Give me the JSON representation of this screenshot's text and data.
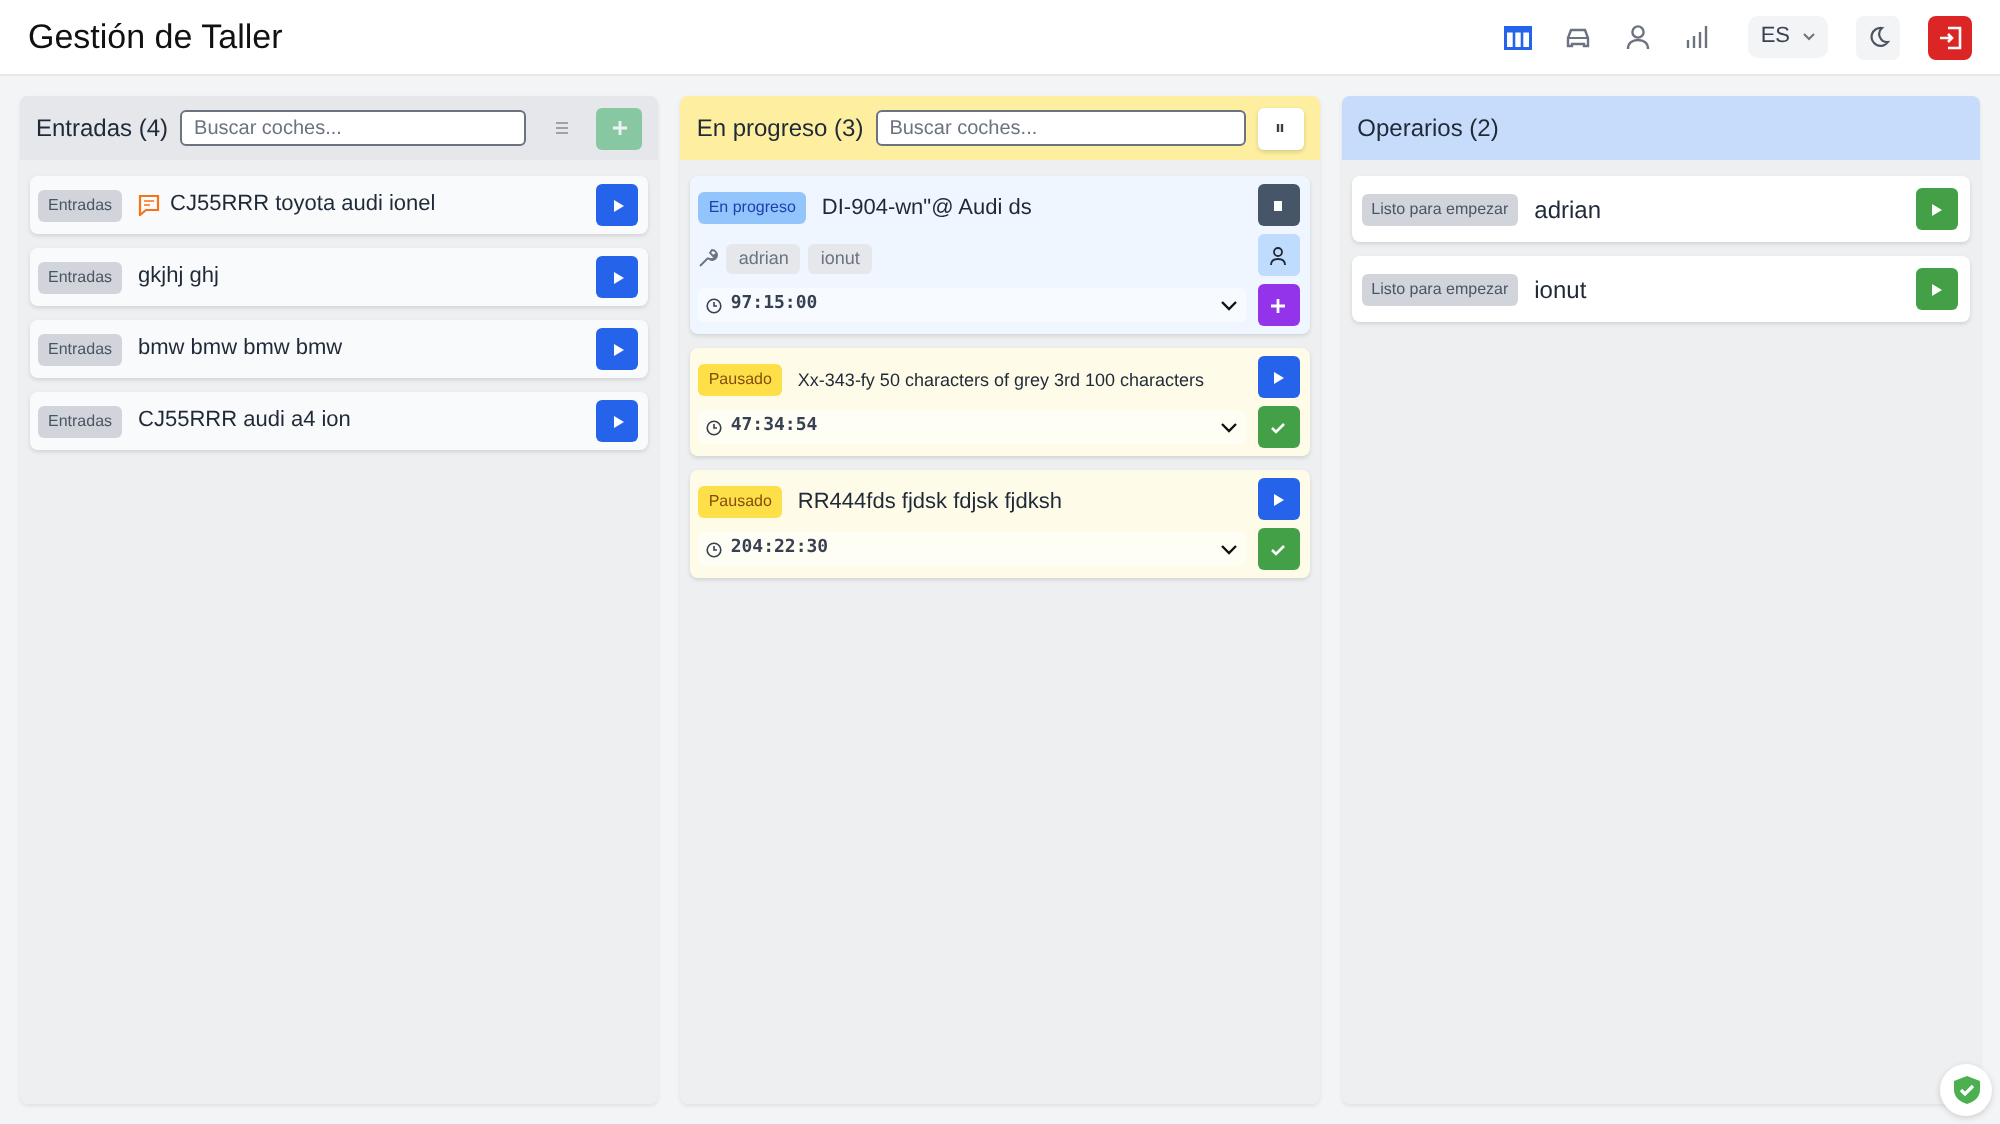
{
  "app_title": "Gestión de Taller",
  "nav_icons": [
    {
      "kind": "board",
      "selected": true
    },
    {
      "kind": "car",
      "selected": false
    },
    {
      "kind": "person",
      "selected": false
    },
    {
      "kind": "stats",
      "selected": false
    }
  ],
  "language": "ES",
  "columns": [
    {
      "kind": "cars",
      "title": "Entradas (4)",
      "color": "#e5e7eb",
      "search": {
        "placeholder": "Buscar coches..."
      },
      "header_buttons": [
        {
          "kind": "list",
          "disabled": false
        },
        {
          "kind": "add",
          "disabled": true
        }
      ],
      "cards": [
        {
          "kind": "entrada",
          "badge": "Entradas",
          "comment": true,
          "title": "CJ55RRR toyota audi ionel",
          "buttons": [
            {
              "kind": "play"
            }
          ]
        },
        {
          "kind": "entrada",
          "badge": "Entradas",
          "title": "gkjhj ghj",
          "buttons": [
            {
              "kind": "play"
            }
          ]
        },
        {
          "kind": "entrada",
          "badge": "Entradas",
          "title": "bmw bmw bmw bmw",
          "buttons": [
            {
              "kind": "play"
            }
          ]
        },
        {
          "kind": "entrada",
          "badge": "Entradas",
          "title": "CJ55RRR audi a4 ion",
          "buttons": [
            {
              "kind": "play"
            }
          ]
        }
      ]
    },
    {
      "kind": "cars",
      "title": "En progreso (3)",
      "color": "#fdef9f",
      "search": {
        "placeholder": "Buscar coches..."
      },
      "header_buttons": [
        {
          "kind": "pause",
          "disabled": false
        }
      ],
      "cards": [
        {
          "kind": "progreso",
          "badge": "En progreso",
          "title": "DI-904-wn\"@ Audi ds",
          "workers": [
            "adrian",
            "ionut"
          ],
          "timer": "97:15:00",
          "expanded": false,
          "buttons": [
            {
              "kind": "stop"
            },
            {
              "kind": "person"
            },
            {
              "kind": "add"
            }
          ]
        },
        {
          "kind": "pausado",
          "badge": "Pausado",
          "small_title": true,
          "title": "Xx-343-fy 50 characters of grey 3rd 100 characters",
          "timer": "47:34:54",
          "expanded": false,
          "buttons": [
            {
              "kind": "play"
            },
            {
              "kind": "done"
            }
          ]
        },
        {
          "kind": "pausado",
          "badge": "Pausado",
          "title": "RR444fds fjdsk fdjsk fjdksh",
          "timer": "204:22:30",
          "expanded": false,
          "buttons": [
            {
              "kind": "play"
            },
            {
              "kind": "done"
            }
          ]
        }
      ]
    },
    {
      "kind": "workers",
      "title": "Operarios (2)",
      "color": "#c7dbfb",
      "cards": [
        {
          "kind": "listo",
          "badge": "Listo para empezar",
          "title": "adrian",
          "buttons": [
            {
              "kind": "go"
            }
          ]
        },
        {
          "kind": "listo",
          "badge": "Listo para empezar",
          "title": "ionut",
          "buttons": [
            {
              "kind": "go"
            }
          ]
        }
      ]
    }
  ]
}
